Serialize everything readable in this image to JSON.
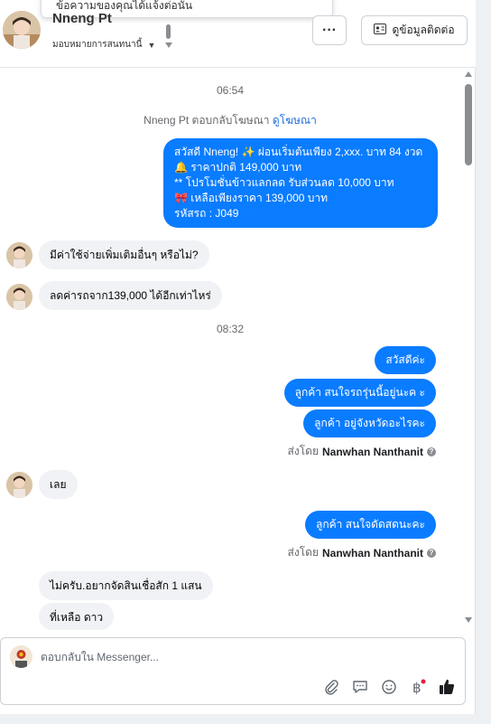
{
  "header": {
    "contact_name": "Nneng Pt",
    "assign_label": "มอบหมายการสนทนานี้",
    "popup_text": "ข้อความของคุณได้แจ้งต่อนั้น",
    "more_label": "···",
    "contact_button_label": "ดูข้อมูลติดต่อ"
  },
  "conversation": {
    "timestamp_1": "06:54",
    "reply_note": "Nneng Pt ตอบกลับโฆษณา",
    "reply_note_link": "ดูโฆษณา",
    "ad_message": {
      "line1": "สวัสดี Nneng! ✨  ผ่อนเริ่มต้นเพียง 2,xxx. บาท 84 งวด",
      "line2": "🔔 ราคาปกติ 149,000 บาท",
      "line3": "** โปรโมชั่นข้าวแลกลด รับส่วนลด 10,000 บาท",
      "line4": "🎀  เหลือเพียงราคา 139,000 บาท",
      "line5": " รหัสรถ : J049"
    },
    "incoming_1": "มีค่าใช้จ่ายเพิ่มเติมอื่นๆ หรือไม่?",
    "incoming_2": "ลดค่ารถจาก139,000 ได้อีกเท่าไหร่",
    "timestamp_2": "08:32",
    "outgoing_1": "สวัสดีค่ะ",
    "outgoing_2": "ลูกค้า สนใจรถรุ่นนี้อยู่นะค ะ",
    "outgoing_3": "ลูกค้า อยู่จังหวัดอะไรคะ",
    "sent_by_prefix": "ส่งโดย",
    "sent_by_name": "Nanwhan Nanthanit",
    "incoming_3": "เลย",
    "outgoing_4": "ลูกค้า สนใจดัดสดนะคะ",
    "incoming_4": "ไม่ครับ.อยากจัดสินเชื่อสัก 1 แสน",
    "incoming_5": "ที่เหลือ ดาว"
  },
  "composer": {
    "placeholder": "ตอบกลับใน Messenger..."
  },
  "colors": {
    "accent": "#0a7cff",
    "bubble_in": "#f0f2f5",
    "link": "#216fdb"
  },
  "icons": [
    "avatar",
    "chevron-down-icon",
    "more-icon",
    "contact-card-icon",
    "info-icon",
    "attach-icon",
    "chat-bubble-icon",
    "emoji-icon",
    "baht-icon",
    "thumbs-up-icon"
  ]
}
